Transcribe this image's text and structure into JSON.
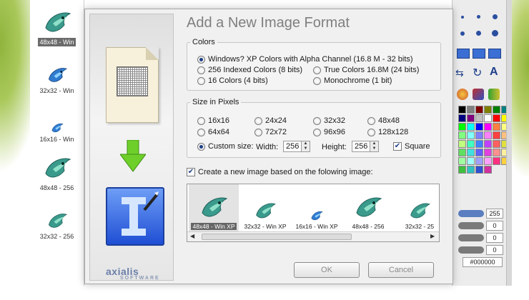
{
  "dialog": {
    "title": "Add a New Image Format",
    "logo_text": "axialis",
    "logo_sub": "SOFTWARE",
    "ok_label": "OK",
    "cancel_label": "Cancel"
  },
  "colors_group": {
    "legend": "Colors",
    "options": [
      {
        "label": "Windows? XP Colors with Alpha Channel (16.8 M - 32 bits)",
        "selected": true
      },
      {
        "label": "256 Indexed Colors (8 bits)",
        "selected": false
      },
      {
        "label": "True Colors 16.8M (24 bits)",
        "selected": false
      },
      {
        "label": "16 Colors (4 bits)",
        "selected": false
      },
      {
        "label": "Monochrome (1 bit)",
        "selected": false
      }
    ]
  },
  "size_group": {
    "legend": "Size in Pixels",
    "options": [
      {
        "label": "16x16",
        "selected": false
      },
      {
        "label": "24x24",
        "selected": false
      },
      {
        "label": "32x32",
        "selected": false
      },
      {
        "label": "48x48",
        "selected": false
      },
      {
        "label": "64x64",
        "selected": false
      },
      {
        "label": "72x72",
        "selected": false
      },
      {
        "label": "96x96",
        "selected": false
      },
      {
        "label": "128x128",
        "selected": false
      }
    ],
    "custom_label": "Custom size:",
    "custom_selected": true,
    "width_label": "Width:",
    "width_value": "256",
    "height_label": "Height:",
    "height_value": "256",
    "square_label": "Square",
    "square_checked": true
  },
  "based_on": {
    "label": "Create a new image based on the folowing image:",
    "checked": true,
    "images": [
      {
        "label": "48x48 - Win XP",
        "selected": true
      },
      {
        "label": "32x32 - Win XP",
        "selected": false
      },
      {
        "label": "16x16 - Win XP",
        "selected": false
      },
      {
        "label": "48x48 - 256",
        "selected": false
      },
      {
        "label": "32x32 - 25",
        "selected": false
      }
    ]
  },
  "left_list": {
    "items": [
      {
        "label": "48x48 - Win",
        "selected": true
      },
      {
        "label": "32x32 - Win",
        "selected": false
      },
      {
        "label": "16x16 - Win",
        "selected": false
      },
      {
        "label": "48x48 - 256",
        "selected": false
      },
      {
        "label": "32x32 - 256",
        "selected": false
      }
    ]
  },
  "right_panel": {
    "values": [
      "255",
      "0",
      "0",
      "0"
    ],
    "hex_value": "#000000",
    "palette_colors": [
      "#000000",
      "#808080",
      "#800000",
      "#808000",
      "#008000",
      "#008080",
      "#000080",
      "#800080",
      "#c0c0c0",
      "#ffffff",
      "#ff0000",
      "#ffff00",
      "#00ff00",
      "#00ffff",
      "#0000ff",
      "#ff00ff",
      "#ff8040",
      "#ffff80",
      "#80ff80",
      "#80ffff",
      "#8080ff",
      "#ff80ff",
      "#ff4040",
      "#ffc080",
      "#c0ff80",
      "#40ffc0",
      "#4080ff",
      "#c040ff",
      "#ff6060",
      "#e0e040",
      "#60e060",
      "#40e0e0",
      "#6060ff",
      "#e040e0",
      "#ff9090",
      "#fff0a0",
      "#a0ffa0",
      "#a0ffff",
      "#a0a0ff",
      "#ffa0ff",
      "#ff3080",
      "#ffd040",
      "#40c040",
      "#30c0c0",
      "#3050d0",
      "#d030a0"
    ]
  },
  "colors": {
    "accent_dark": "#1d3f86",
    "icon_blue": "#1f4ed4",
    "arrow_green": "#5fba1e"
  }
}
